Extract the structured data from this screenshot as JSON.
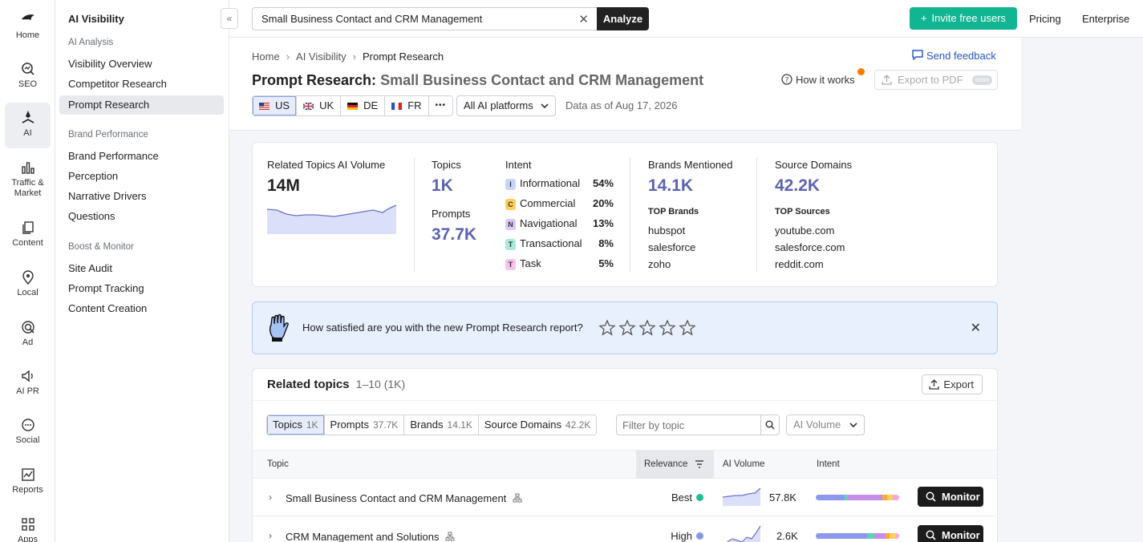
{
  "rail": {
    "items": [
      {
        "label": "Home",
        "icon": "home-icon"
      },
      {
        "label": "SEO",
        "icon": "seo-icon"
      },
      {
        "label": "AI",
        "icon": "ai-icon",
        "active": true
      },
      {
        "label": "Traffic & Market",
        "icon": "traffic-icon"
      },
      {
        "label": "Content",
        "icon": "content-icon"
      },
      {
        "label": "Local",
        "icon": "local-icon"
      },
      {
        "label": "Ad",
        "icon": "ad-icon"
      },
      {
        "label": "AI PR",
        "icon": "ai-pr-icon"
      },
      {
        "label": "Social",
        "icon": "social-icon"
      },
      {
        "label": "Reports",
        "icon": "reports-icon"
      },
      {
        "label": "Apps",
        "icon": "apps-icon"
      }
    ]
  },
  "sidebar": {
    "title": "AI Visibility",
    "sections": [
      {
        "title": "AI Analysis",
        "links": [
          "Visibility Overview",
          "Competitor Research",
          "Prompt Research"
        ]
      },
      {
        "title": "Brand Performance",
        "links": [
          "Brand Performance",
          "Perception",
          "Narrative Drivers",
          "Questions"
        ]
      },
      {
        "title": "Boost & Monitor",
        "links": [
          "Site Audit",
          "Prompt Tracking",
          "Content Creation"
        ]
      }
    ],
    "active_link": "Prompt Research"
  },
  "topbar": {
    "search_value": "Small Business Contact and CRM Management",
    "analyze_label": "Analyze",
    "invite_label": "Invite free users",
    "pricing_label": "Pricing",
    "enterprise_label": "Enterprise"
  },
  "header": {
    "breadcrumbs": [
      "Home",
      "AI Visibility",
      "Prompt Research"
    ],
    "feedback_label": "Send feedback",
    "title_prefix": "Prompt Research:",
    "title_topic": "Small Business Contact and CRM Management",
    "how_it_works": "How it works",
    "export_pdf": "Export to PDF",
    "soon_badge": "soon",
    "countries": [
      {
        "code": "US",
        "active": true
      },
      {
        "code": "UK"
      },
      {
        "code": "DE"
      },
      {
        "code": "FR"
      }
    ],
    "more_label": "•••",
    "platforms_label": "All AI platforms",
    "data_as": "Data as of Aug 17, 2026"
  },
  "summary": {
    "volume_label": "Related Topics AI Volume",
    "volume_value": "14M",
    "topics_label": "Topics",
    "topics_value": "1K",
    "prompts_label": "Prompts",
    "prompts_value": "37.7K",
    "intent_label": "Intent",
    "intents": [
      {
        "badge": "I",
        "label": "Informational",
        "pct": "54%",
        "color": "#c9d3f7"
      },
      {
        "badge": "C",
        "label": "Commercial",
        "pct": "20%",
        "color": "#ffcf5c"
      },
      {
        "badge": "N",
        "label": "Navigational",
        "pct": "13%",
        "color": "#dcc8f9"
      },
      {
        "badge": "T",
        "label": "Transactional",
        "pct": "8%",
        "color": "#a8ead8"
      },
      {
        "badge": "T",
        "label": "Task",
        "pct": "5%",
        "color": "#f7c3ec"
      }
    ],
    "brands_label": "Brands Mentioned",
    "brands_value": "14.1K",
    "top_brands_label": "TOP Brands",
    "top_brands": [
      "hubspot",
      "salesforce",
      "zoho"
    ],
    "domains_label": "Source Domains",
    "domains_value": "42.2K",
    "top_sources_label": "TOP Sources",
    "top_sources": [
      "youtube.com",
      "salesforce.com",
      "reddit.com"
    ]
  },
  "banner": {
    "question": "How satisfied are you with the new Prompt Research report?",
    "stars": 5
  },
  "related": {
    "title": "Related topics",
    "range": "1–10 (1K)",
    "export_label": "Export",
    "tabs": [
      {
        "label": "Topics",
        "count": "1K",
        "active": true
      },
      {
        "label": "Prompts",
        "count": "37.7K"
      },
      {
        "label": "Brands",
        "count": "14.1K"
      },
      {
        "label": "Source Domains",
        "count": "42.2K"
      }
    ],
    "filter_placeholder": "Filter by topic",
    "volume_select": "AI Volume",
    "columns": {
      "topic": "Topic",
      "relevance": "Relevance",
      "volume": "AI Volume",
      "intent": "Intent"
    },
    "rows": [
      {
        "topic": "Small Business Contact and CRM Management",
        "relevance": "Best",
        "relevance_color": "#1fbf8f",
        "volume": "57.8K",
        "monitor": "Monitor",
        "intent_mix": [
          0.35,
          0.03,
          0.42,
          0.06,
          0.06,
          0.08
        ]
      },
      {
        "topic": "CRM Management and Solutions",
        "relevance": "High",
        "relevance_color": "#8b95e8",
        "volume": "2.6K",
        "monitor": "Monitor",
        "intent_mix": [
          0.62,
          0.08,
          0.14,
          0.04,
          0.08,
          0.04
        ]
      }
    ]
  }
}
